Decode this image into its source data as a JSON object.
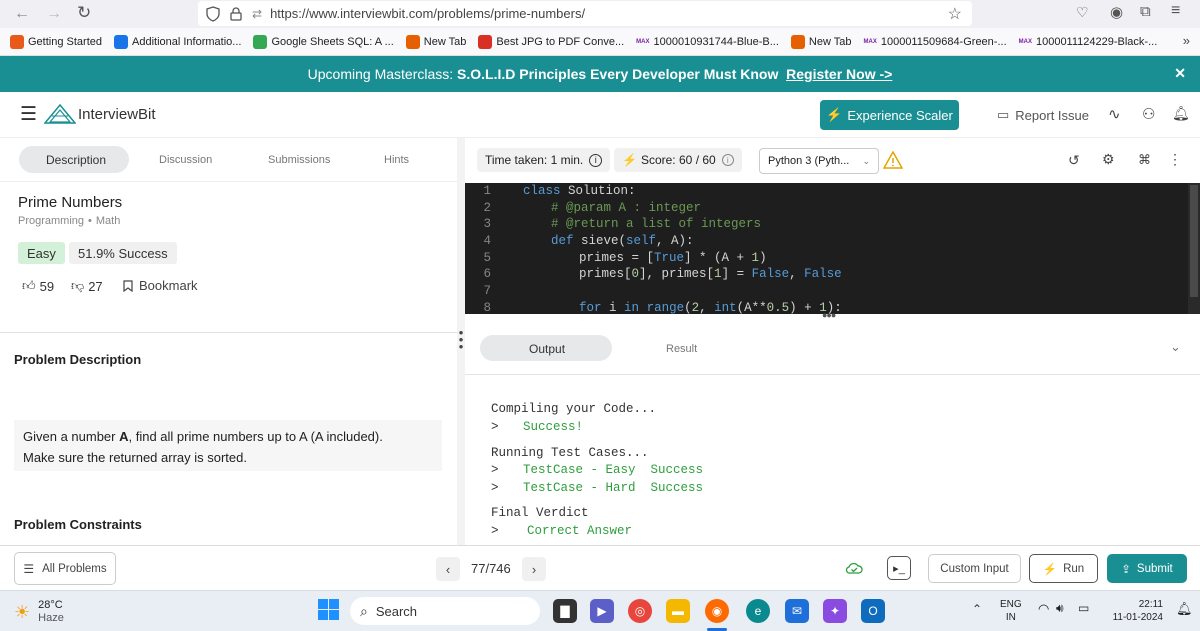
{
  "browser": {
    "url": "https://www.interviewbit.com/problems/prime-numbers/",
    "bookmarks": [
      {
        "label": "Getting Started",
        "color": "#e8591a"
      },
      {
        "label": "Additional Informatio...",
        "color": "#1a73e8"
      },
      {
        "label": "Google Sheets SQL: A ...",
        "color": "#34a853"
      },
      {
        "label": "New Tab",
        "color": "#e66000"
      },
      {
        "label": "Best JPG to PDF Conve...",
        "color": "#d93025"
      },
      {
        "label": "1000010931744-Blue-B...",
        "color": "#7b1fa2"
      },
      {
        "label": "New Tab",
        "color": "#e66000"
      },
      {
        "label": "1000011509684-Green-...",
        "color": "#7b1fa2"
      },
      {
        "label": "1000011124229-Black-...",
        "color": "#7b1fa2"
      }
    ],
    "bookmark_prefix": "MAX"
  },
  "banner": {
    "prefix": "Upcoming Masterclass:",
    "title": "S.O.L.I.D Principles Every Developer Must Know",
    "cta": "Register Now ->",
    "close": "✕"
  },
  "header": {
    "brand": "InterviewBit",
    "experience_label": "Experience Scaler",
    "report_label": "Report Issue"
  },
  "left": {
    "tabs": [
      "Description",
      "Discussion",
      "Submissions",
      "Hints"
    ],
    "problem_title": "Prime Numbers",
    "category": "Programming",
    "subcategory": "Math",
    "difficulty": "Easy",
    "success_rate": "51.9% Success",
    "likes": "59",
    "dislikes": "27",
    "bookmark": "Bookmark",
    "desc_heading": "Problem Description",
    "desc_line1_pre": "Given a number ",
    "desc_line1_bold": "A",
    "desc_line1_post": ", find all prime numbers up to A (A included).",
    "desc_line2": "Make sure the returned array is sorted.",
    "constraints_heading": "Problem Constraints"
  },
  "editor": {
    "time_label": "Time taken: 1 min.",
    "score_label": "Score:",
    "score_value": "60",
    "score_sep": "/",
    "score_max": "60",
    "language": "Python 3 (Pyth...",
    "lines": [
      {
        "n": "1",
        "indent": 0,
        "parts": [
          [
            "kw",
            "class"
          ],
          [
            "",
            " Solution:"
          ]
        ]
      },
      {
        "n": "2",
        "indent": 1,
        "parts": [
          [
            "cm",
            "# @param A : integer"
          ]
        ]
      },
      {
        "n": "3",
        "indent": 1,
        "parts": [
          [
            "cm",
            "# @return a list of integers"
          ]
        ]
      },
      {
        "n": "4",
        "indent": 1,
        "parts": [
          [
            "kw",
            "def"
          ],
          [
            "",
            " sieve("
          ],
          [
            "kw",
            "self"
          ],
          [
            "",
            ", A):"
          ]
        ]
      },
      {
        "n": "5",
        "indent": 2,
        "parts": [
          [
            "",
            "primes = ["
          ],
          [
            "kw",
            "True"
          ],
          [
            "",
            "] * (A + "
          ],
          [
            "nm",
            "1"
          ],
          [
            "",
            ")"
          ]
        ]
      },
      {
        "n": "6",
        "indent": 2,
        "parts": [
          [
            "",
            "primes["
          ],
          [
            "nm",
            "0"
          ],
          [
            "",
            "], primes["
          ],
          [
            "nm",
            "1"
          ],
          [
            "",
            "] = "
          ],
          [
            "kw",
            "False"
          ],
          [
            "",
            ", "
          ],
          [
            "kw",
            "False"
          ]
        ]
      },
      {
        "n": "7",
        "indent": 0,
        "parts": []
      },
      {
        "n": "8",
        "indent": 2,
        "parts": [
          [
            "kw",
            "for"
          ],
          [
            "",
            " i "
          ],
          [
            "kw",
            "in"
          ],
          [
            "",
            " "
          ],
          [
            "kw",
            "range"
          ],
          [
            "",
            "("
          ],
          [
            "nm",
            "2"
          ],
          [
            "",
            ", "
          ],
          [
            "kw",
            "int"
          ],
          [
            "",
            "(A**"
          ],
          [
            "nm",
            "0.5"
          ],
          [
            "",
            ") + "
          ],
          [
            "nm",
            "1"
          ],
          [
            "",
            "):"
          ]
        ]
      }
    ]
  },
  "output": {
    "tabs": [
      "Output",
      "Result"
    ],
    "compiling": "Compiling your Code...",
    "compile_result": "Success!",
    "running": "Running Test Cases...",
    "tests": [
      {
        "name": "TestCase - Easy",
        "status": "Success"
      },
      {
        "name": "TestCase - Hard",
        "status": "Success"
      }
    ],
    "prompt": ">",
    "verdict_heading": "Final Verdict",
    "verdict": "Correct Answer"
  },
  "footer": {
    "all_problems": "All Problems",
    "pagination": "77/746",
    "custom_input": "Custom Input",
    "run": "Run",
    "submit": "Submit"
  },
  "taskbar": {
    "temp": "28°C",
    "weather": "Haze",
    "search": "Search",
    "lang1": "ENG",
    "lang2": "IN",
    "time": "22:11",
    "date": "11-01-2024"
  },
  "colors": {
    "teal": "#1a8f93",
    "success_green": "#2e9e3e",
    "easy_bg": "#d3f0d8"
  }
}
